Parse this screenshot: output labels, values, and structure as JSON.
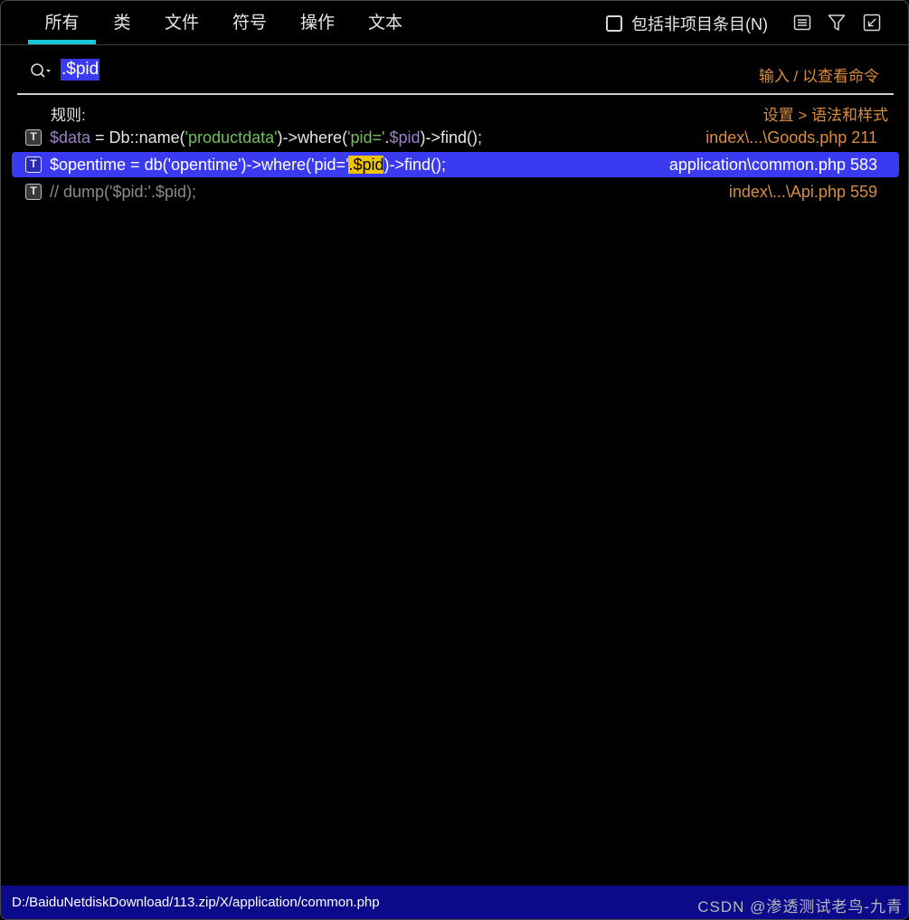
{
  "tabs": [
    {
      "label": "所有",
      "active": true
    },
    {
      "label": "类",
      "active": false
    },
    {
      "label": "文件",
      "active": false
    },
    {
      "label": "符号",
      "active": false
    },
    {
      "label": "操作",
      "active": false
    },
    {
      "label": "文本",
      "active": false
    }
  ],
  "include_non_project": {
    "label": "包括非项目条目(N)",
    "checked": false
  },
  "toolbar_icons": [
    "filter-list-icon",
    "funnel-icon",
    "collapse-icon"
  ],
  "search": {
    "value": ".$pid",
    "hint": "输入 / 以查看命令"
  },
  "rules": {
    "label": "规则:",
    "settings_link": "设置 > 语法和样式"
  },
  "results": [
    {
      "icon": "T",
      "code_parts": [
        "$data",
        " = Db::name(",
        "'productdata'",
        ")->where(",
        "'pid='",
        ".",
        "$pid",
        ")->find();"
      ],
      "location": "index\\...\\Goods.php 211",
      "selected": false
    },
    {
      "icon": "T",
      "code_parts": [
        "$opentime = db('opentime')->where('pid='",
        ".$pid",
        ")->find();"
      ],
      "location": "application\\common.php 583",
      "selected": true
    },
    {
      "icon": "T",
      "code_parts": [
        "// dump('$pid:'.$pid);"
      ],
      "location": "index\\...\\Api.php 559",
      "selected": false
    }
  ],
  "status": {
    "path": "D:/BaiduNetdiskDownload/113.zip/X/application/common.php",
    "watermark": "CSDN @渗透测试老鸟-九青"
  },
  "colors": {
    "accent": "#19c6d6",
    "selection": "#3a3af0",
    "hint": "#d98e3f",
    "match_highlight": "#f0c400",
    "status_bar": "#0a0a8a"
  }
}
